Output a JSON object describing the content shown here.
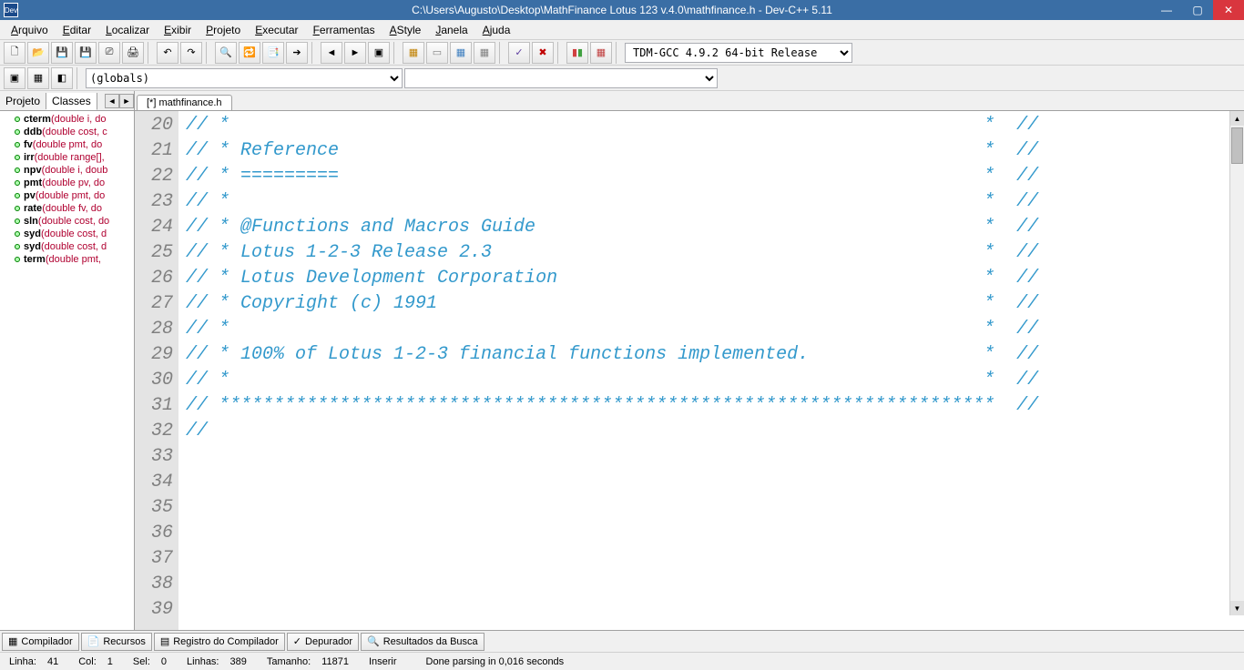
{
  "window": {
    "title": "C:\\Users\\Augusto\\Desktop\\MathFinance Lotus 123 v.4.0\\mathfinance.h - Dev-C++ 5.11",
    "app_icon_label": "Dev"
  },
  "menu": [
    "Arquivo",
    "Editar",
    "Localizar",
    "Exibir",
    "Projeto",
    "Executar",
    "Ferramentas",
    "AStyle",
    "Janela",
    "Ajuda"
  ],
  "menu_underline": [
    "A",
    "E",
    "L",
    "E",
    "P",
    "E",
    "F",
    "A",
    "J",
    "A"
  ],
  "compiler_selector": "TDM-GCC 4.9.2 64-bit Release",
  "scope_selector": "(globals)",
  "sidebar": {
    "tabs": {
      "project": "Projeto",
      "classes": "Classes"
    },
    "items": [
      {
        "name": "cterm",
        "sig": "(double i, do"
      },
      {
        "name": "ddb",
        "sig": "(double cost, c"
      },
      {
        "name": "fv",
        "sig": "(double pmt, do"
      },
      {
        "name": "irr",
        "sig": "(double range[],"
      },
      {
        "name": "npv",
        "sig": "(double i, doub"
      },
      {
        "name": "pmt",
        "sig": "(double pv, do"
      },
      {
        "name": "pv",
        "sig": "(double pmt, do"
      },
      {
        "name": "rate",
        "sig": "(double fv, do"
      },
      {
        "name": "sln",
        "sig": "(double cost, do"
      },
      {
        "name": "syd",
        "sig": "(double cost, d"
      },
      {
        "name": "syd",
        "sig": "(double cost, d"
      },
      {
        "name": "term",
        "sig": "(double pmt,"
      }
    ]
  },
  "editor": {
    "tab_label": "[*] mathfinance.h",
    "first_line": 20,
    "last_line": 39,
    "lines": [
      "// *                                                                     *  //",
      "// * Reference                                                           *  //",
      "// * =========                                                           *  //",
      "// *                                                                     *  //",
      "// * @Functions and Macros Guide                                         *  //",
      "// * Lotus 1-2-3 Release 2.3                                             *  //",
      "// * Lotus Development Corporation                                       *  //",
      "// * Copyright (c) 1991                                                  *  //",
      "// *                                                                     *  //",
      "// * 100% of Lotus 1-2-3 financial functions implemented.                *  //",
      "// *                                                                     *  //",
      "// ***********************************************************************  //",
      "//",
      "",
      "",
      "",
      "",
      "",
      "",
      ""
    ]
  },
  "bottom_tabs": [
    "Compilador",
    "Recursos",
    "Registro do Compilador",
    "Depurador",
    "Resultados da Busca"
  ],
  "status": {
    "line_label": "Linha:",
    "line_val": "41",
    "col_label": "Col:",
    "col_val": "1",
    "sel_label": "Sel:",
    "sel_val": "0",
    "lines_label": "Linhas:",
    "lines_val": "389",
    "size_label": "Tamanho:",
    "size_val": "11871",
    "mode": "Inserir",
    "parse": "Done parsing in 0,016 seconds"
  }
}
